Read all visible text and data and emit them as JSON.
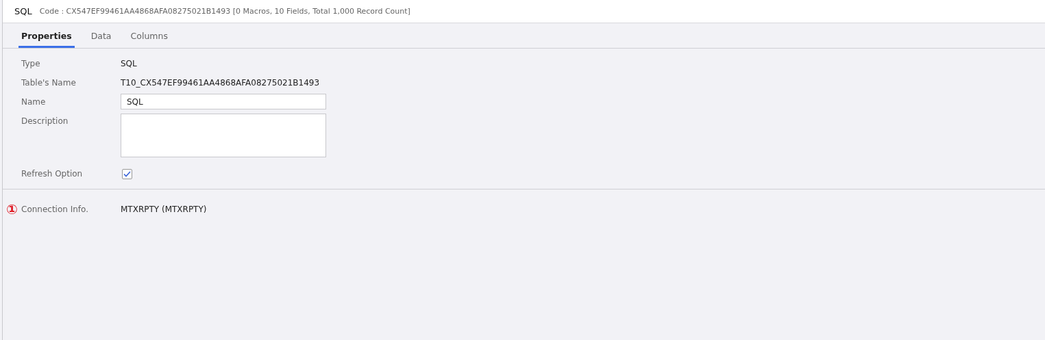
{
  "header": {
    "title": "SQL",
    "code_info": "Code : CX547EF99461AA4868AFA08275021B1493 [0 Macros, 10 Fields, Total 1,000 Record Count]"
  },
  "tabs": [
    {
      "label": "Properties",
      "selected": true
    },
    {
      "label": "Data",
      "selected": false
    },
    {
      "label": "Columns",
      "selected": false
    }
  ],
  "properties": [
    {
      "kind": "text",
      "label": "Type",
      "value": "SQL"
    },
    {
      "kind": "text",
      "label": "Table's Name",
      "value": "T10_CX547EF99461AA4868AFA08275021B1493"
    },
    {
      "kind": "input",
      "label": "Name",
      "value": "SQL"
    },
    {
      "kind": "textarea",
      "label": "Description"
    },
    {
      "kind": "checkbox",
      "label": "Refresh Option",
      "checked": true
    }
  ],
  "connection": {
    "marker": "①",
    "label": "Connection Info.",
    "value": "MTXRPTY (MTXRPTY)"
  }
}
